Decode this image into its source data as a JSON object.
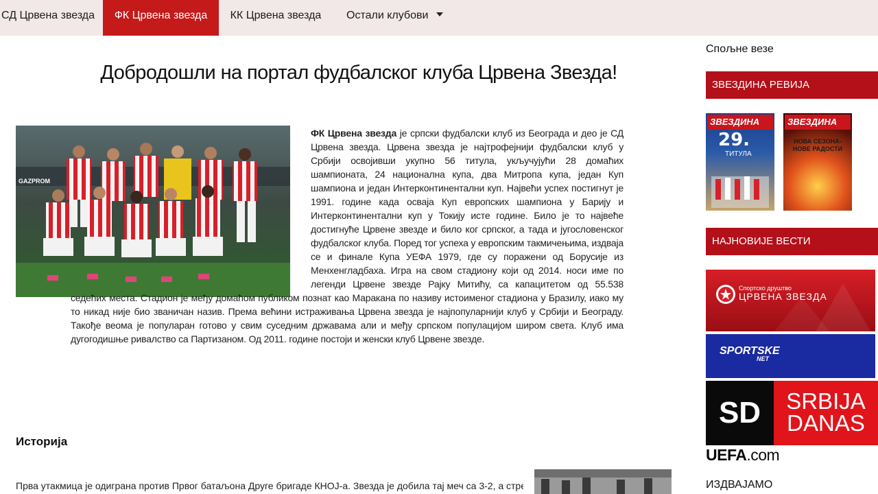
{
  "nav": {
    "items": [
      {
        "label": "СД Црвена звезда"
      },
      {
        "label": "ФК Црвена звезда"
      },
      {
        "label": "КК Црвена звезда"
      },
      {
        "label": "Остали клубови"
      }
    ],
    "active_color": "#c41a1a",
    "background": "#f2e8e8"
  },
  "main": {
    "title": "Добродошли на портал фудбалског клуба Црвена Звезда!",
    "intro_bold": "ФК Црвена звезда",
    "intro_text": " је српски фудбалски клуб из Београда и део је СД Црвена звезда. Црвена звезда је најтрофејнији фудбалски клуб у Србији освојивши укупно 56 титула, укључујући 28 домаћих шампионата, 24 национална купа, два Митропа купа, један Куп шампиона и један Интерконтинентални куп. Највећи успех постигнут је 1991. године када осваја Куп европских шампиона у Барију и Интерконтинентални куп у Токију исте године. Било је то највеће достигнуће Црвене звезде и било ког српског, а тада и југословенског фудбалског клуба. Поред тог успеха у европским такмичењима, издваја се и финале Купа УЕФА 1979, где су поражени од Борусије из Менхенгладбаха. Игра на свом стадиону који од 2014. носи име по легенди Црвене звезде Рајку Митићу, са капацитетом од 55.538 седећих места. Стадион је међу домаћом публиком познат као Маракана по називу истоименог стадиона у Бразилу, иако му то никад није био званичан назив. Према већини истраживања Црвена звезда је најпопуларнији клуб у Србији и Београду. Такође веома је популаран готово у свим суседним државама али и међу српском популацијом широм света. Клуб има дугогодишње ривалство са Партизаном. Од 2011. године постоји и женски клуб Црвене звезде.",
    "history_heading": "Историја",
    "history_text": "Прва утакмица је одиграна против Првог батаљона Друге бригаде КНОЈ-а. Звезда је добила тај меч са 3-2, а стрелац"
  },
  "sidebar": {
    "links_heading": "Спољне везе",
    "revija_banner": "ЗВЕЗДИНА РЕВИЈА",
    "magazines": [
      {
        "title": "ЗВЕЗДИНА",
        "big": "29.",
        "sub": "ТИТУЛА"
      },
      {
        "title": "ЗВЕЗДИНА",
        "caption": "НОВА СЕЗОНА-НОВЕ РАДОСТИ"
      }
    ],
    "news_banner": "НАЈНОВИЈЕ ВЕСТИ",
    "ads": {
      "sdcz_small": "Спортско друштво",
      "sdcz_big": "ЦРВЕНА ЗВЕЗДА",
      "sportske_line1": "SPORTSKE",
      "sportske_line2": "NET",
      "sd_left": "SD",
      "sd_right_1": "SRBIJA",
      "sd_right_2": "DANAS",
      "uefa_bold": "UEFA",
      "uefa_rest": ".com"
    },
    "featured_heading": "ИЗДВАЈАМО",
    "banner_color": "#b3101a"
  }
}
